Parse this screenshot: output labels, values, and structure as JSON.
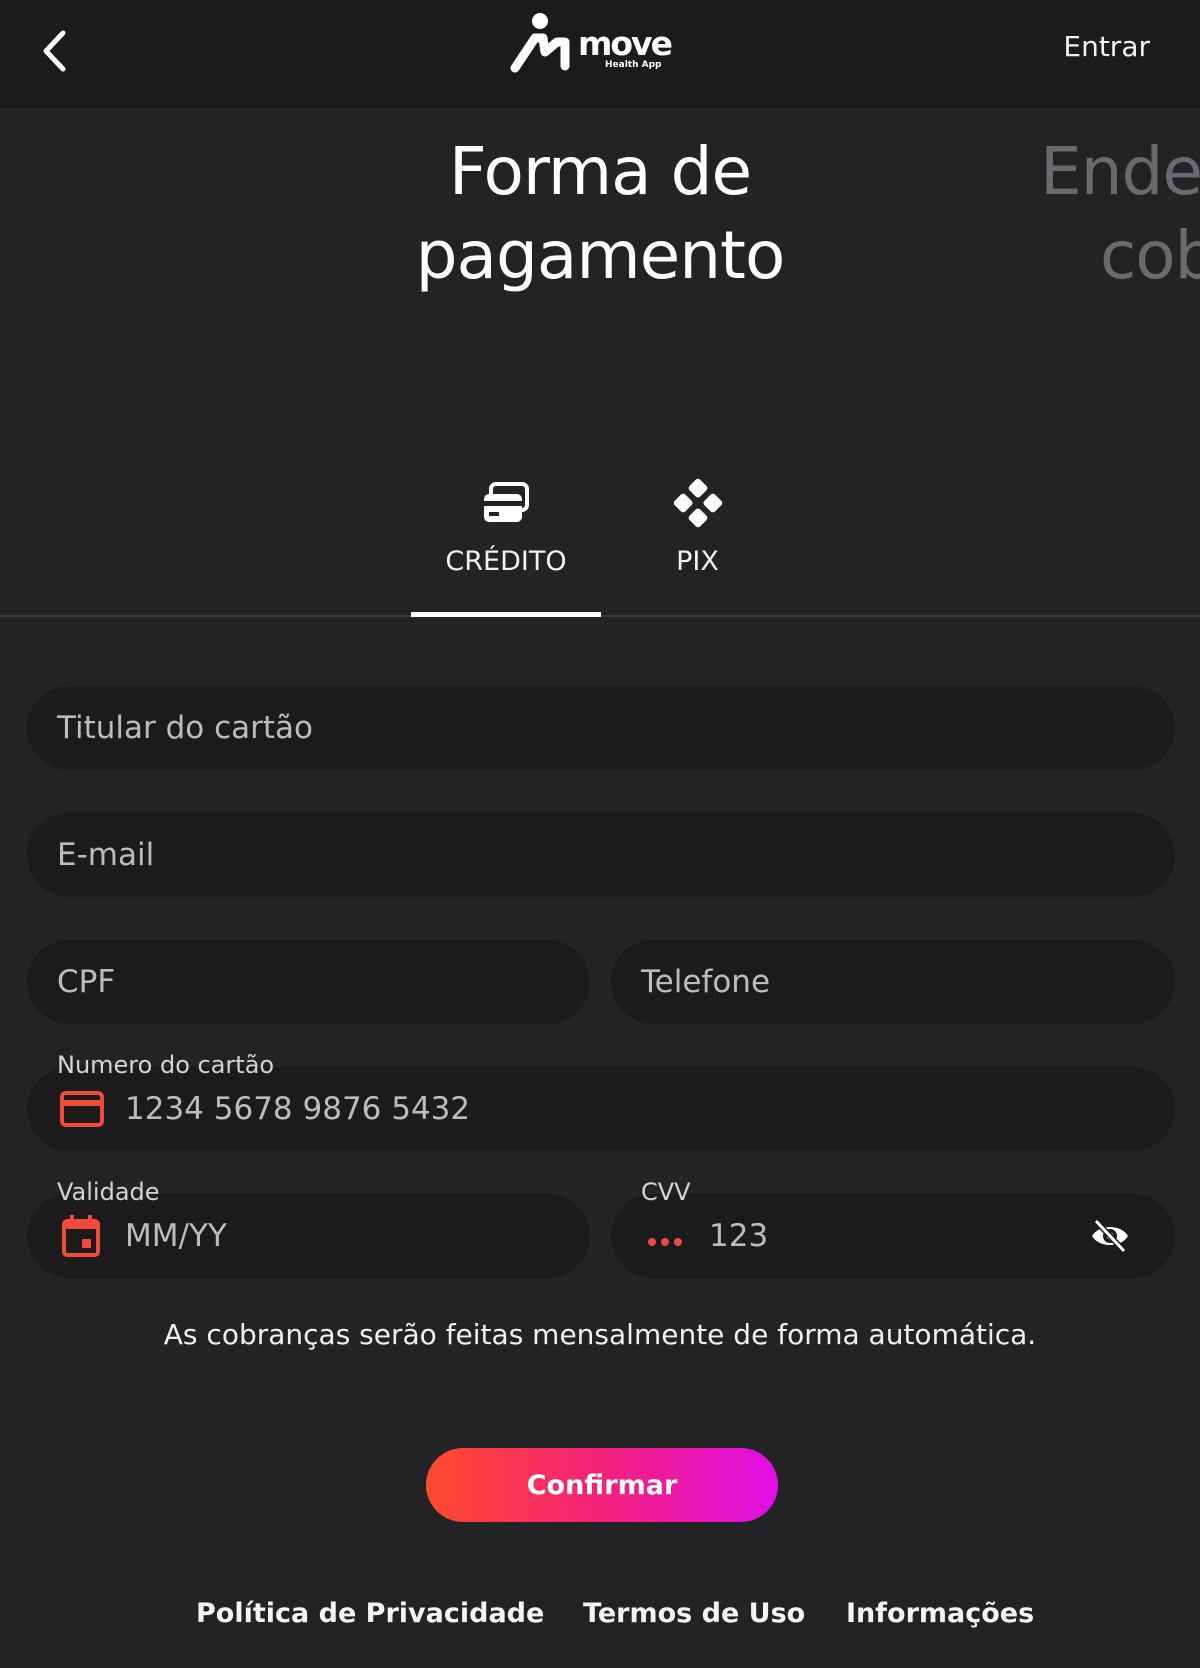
{
  "header": {
    "brand_name": "move",
    "brand_tagline": "Health App",
    "login_label": "Entrar"
  },
  "steps": {
    "current_title_line1": "Forma de",
    "current_title_line2": "pagamento",
    "next_title_line1": "Ende",
    "next_title_line2": "cob"
  },
  "payment_tabs": [
    {
      "label": "CRÉDITO",
      "icon": "credit-cards-icon",
      "selected": true
    },
    {
      "label": "PIX",
      "icon": "pix-icon",
      "selected": false
    }
  ],
  "form": {
    "cardholder_placeholder": "Titular do cartão",
    "email_placeholder": "E-mail",
    "cpf_placeholder": "CPF",
    "phone_placeholder": "Telefone",
    "card_number_label": "Numero do cartão",
    "card_number_placeholder": "1234 5678 9876 5432",
    "expiry_label": "Validade",
    "expiry_placeholder": "MM/YY",
    "cvv_label": "CVV",
    "cvv_placeholder": "123"
  },
  "notice": "As cobranças serão feitas mensalmente de forma automática.",
  "confirm_label": "Confirmar",
  "footer": {
    "privacy": "Política de Privacidade",
    "terms": "Termos de Uso",
    "info": "Informações"
  },
  "colors": {
    "background": "#232326",
    "header_bg": "#1b1b1d",
    "field_bg": "#1b1b1d",
    "accent_red": "#f04a3a",
    "button_gradient_start": "#ff4a2c",
    "button_gradient_end": "#e00ee8"
  }
}
